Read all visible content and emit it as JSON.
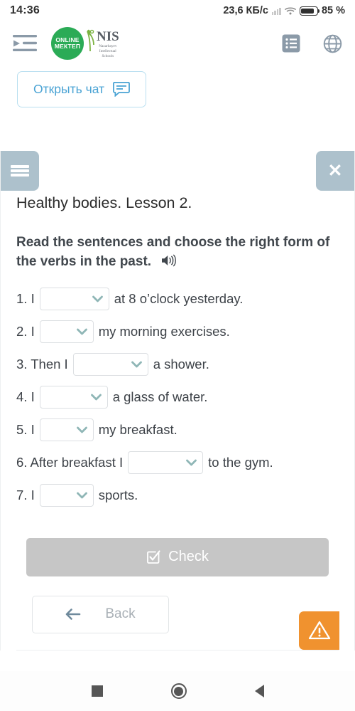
{
  "statusbar": {
    "time": "14:36",
    "network_speed": "23,6 КБ/с",
    "battery_percent": "85 %",
    "signal_icon": "cellular-signal-icon",
    "wifi_icon": "wifi-icon",
    "battery_icon": "battery-icon"
  },
  "appbar": {
    "menu_icon": "indent-list-icon",
    "brand_line1": "ONLINE",
    "brand_line2": "МЕКТЕП",
    "nis_main": "NIS",
    "nis_sub": "Nazarbayev\nIntellectual\nSchools",
    "list_icon": "list-view-icon",
    "globe_icon": "globe-language-icon"
  },
  "chat": {
    "label": "Открыть чат",
    "icon": "chat-bubble-icon",
    "accent": "#4aa3d4"
  },
  "card": {
    "hamburger_icon": "hamburger-menu-icon",
    "close_icon": "close-icon",
    "topbar_color": "#adc1cc",
    "lesson_title": "Healthy bodies. Lesson 2.",
    "instruction": "Read the sentences and choose the right form of the verbs in the past.",
    "speaker_icon": "speaker-audio-icon"
  },
  "questions": [
    {
      "number": "1.",
      "before": "1. I",
      "after": "at 8 o’clock yesterday.",
      "value": "",
      "width": 98
    },
    {
      "number": "2.",
      "before": "2. I",
      "after": "my morning exercises.",
      "value": "",
      "width": 76
    },
    {
      "number": "3.",
      "before": "3. Then I",
      "after": "a shower.",
      "value": "",
      "width": 106
    },
    {
      "number": "4.",
      "before": "4. I",
      "after": "a glass of water.",
      "value": "",
      "width": 96
    },
    {
      "number": "5.",
      "before": "5. I",
      "after": "my breakfast.",
      "value": "",
      "width": 76
    },
    {
      "number": "6.",
      "before": "6. After breakfast I",
      "after": "to the gym.",
      "value": "",
      "width": 106
    },
    {
      "number": "7.",
      "before": "7. I",
      "after": "sports.",
      "value": "",
      "width": 76
    }
  ],
  "select_placeholder": "",
  "actions": {
    "check_label": "Check",
    "check_icon": "checkbox-checked-icon",
    "check_disabled": true,
    "check_bg": "#c6c6c6",
    "back_label": "Back",
    "back_icon": "arrow-left-icon",
    "warning_icon": "warning-triangle-icon",
    "warning_bg": "#f0922f"
  },
  "navbar": {
    "recents_icon": "recents-square-icon",
    "home_icon": "home-circle-icon",
    "back_icon": "back-triangle-icon"
  }
}
